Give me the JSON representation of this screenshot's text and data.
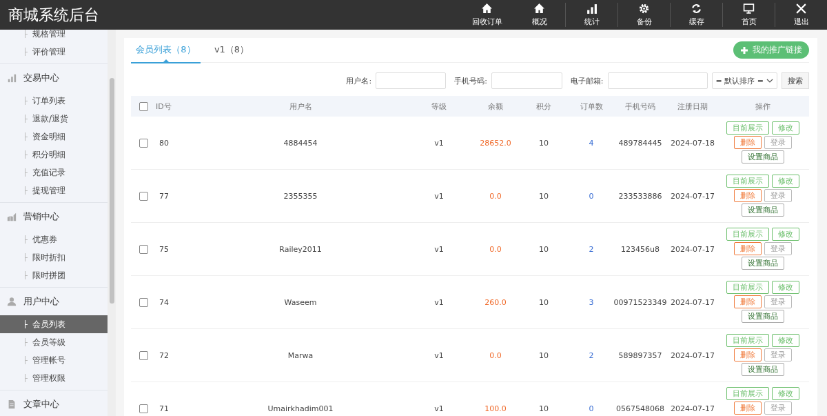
{
  "header": {
    "title": "商城系统后台",
    "nav": [
      {
        "label": "回收订单"
      },
      {
        "label": "概况"
      },
      {
        "label": "统计"
      },
      {
        "label": "备份"
      },
      {
        "label": "缓存"
      },
      {
        "label": "首页"
      },
      {
        "label": "退出"
      }
    ]
  },
  "sidebar": {
    "sections": [
      {
        "items": [
          {
            "label": "规格管理",
            "selected": false
          },
          {
            "label": "评价管理",
            "selected": false
          }
        ]
      },
      {
        "title": "交易中心",
        "items": [
          {
            "label": "订单列表",
            "selected": false
          },
          {
            "label": "退款/退货",
            "selected": false
          },
          {
            "label": "资金明细",
            "selected": false
          },
          {
            "label": "积分明细",
            "selected": false
          },
          {
            "label": "充值记录",
            "selected": false
          },
          {
            "label": "提现管理",
            "selected": false
          }
        ]
      },
      {
        "title": "营销中心",
        "items": [
          {
            "label": "优惠券",
            "selected": false
          },
          {
            "label": "限时折扣",
            "selected": false
          },
          {
            "label": "限时拼团",
            "selected": false
          }
        ]
      },
      {
        "title": "用户中心",
        "items": [
          {
            "label": "会员列表",
            "selected": true
          },
          {
            "label": "会员等级",
            "selected": false
          },
          {
            "label": "管理帐号",
            "selected": false
          },
          {
            "label": "管理权限",
            "selected": false
          }
        ]
      },
      {
        "title": "文章中心"
      }
    ]
  },
  "tabs": [
    {
      "label": "会员列表（8）",
      "selected": true
    },
    {
      "label": "v1（8）",
      "selected": false
    }
  ],
  "promo_button": "我的推广链接",
  "filters": {
    "fields": [
      {
        "label": "用户名:"
      },
      {
        "label": "手机号码:"
      },
      {
        "label": "电子邮箱:"
      }
    ],
    "sort": "= 默认排序 =",
    "search": "搜索"
  },
  "table": {
    "all_checked": false,
    "columns": [
      "ID号",
      "用户名",
      "等级",
      "余额",
      "积分",
      "订单数",
      "手机号码",
      "注册日期",
      "操作"
    ],
    "rows": [
      {
        "checked": false,
        "cells": [
          "80",
          "4884454",
          "v1",
          "28652.0",
          "10",
          "4",
          "489784445",
          "2024-07-18"
        ],
        "actions": [
          {
            "label": "目前展示",
            "kind": "show"
          },
          {
            "label": "修改",
            "kind": "edit"
          },
          {
            "label": "删除",
            "kind": "delete"
          },
          {
            "label": "登录",
            "kind": "login"
          },
          {
            "label": "设置商品",
            "kind": "goods"
          }
        ]
      },
      {
        "checked": false,
        "cells": [
          "77",
          "2355355",
          "v1",
          "0.0",
          "10",
          "0",
          "233533886",
          "2024-07-17"
        ],
        "actions": [
          {
            "label": "目前展示",
            "kind": "show"
          },
          {
            "label": "修改",
            "kind": "edit"
          },
          {
            "label": "删除",
            "kind": "delete"
          },
          {
            "label": "登录",
            "kind": "login"
          },
          {
            "label": "设置商品",
            "kind": "goods"
          }
        ]
      },
      {
        "checked": false,
        "cells": [
          "75",
          "Railey2011",
          "v1",
          "0.0",
          "10",
          "2",
          "123456u8",
          "2024-07-17"
        ],
        "actions": [
          {
            "label": "目前展示",
            "kind": "show"
          },
          {
            "label": "修改",
            "kind": "edit"
          },
          {
            "label": "删除",
            "kind": "delete"
          },
          {
            "label": "登录",
            "kind": "login"
          },
          {
            "label": "设置商品",
            "kind": "goods"
          }
        ]
      },
      {
        "checked": false,
        "cells": [
          "74",
          "Waseem",
          "v1",
          "260.0",
          "10",
          "3",
          "00971523349",
          "2024-07-17"
        ],
        "actions": [
          {
            "label": "目前展示",
            "kind": "show"
          },
          {
            "label": "修改",
            "kind": "edit"
          },
          {
            "label": "删除",
            "kind": "delete"
          },
          {
            "label": "登录",
            "kind": "login"
          },
          {
            "label": "设置商品",
            "kind": "goods"
          }
        ]
      },
      {
        "checked": false,
        "cells": [
          "72",
          "Marwa",
          "v1",
          "0.0",
          "10",
          "2",
          "589897357",
          "2024-07-17"
        ],
        "actions": [
          {
            "label": "目前展示",
            "kind": "show"
          },
          {
            "label": "修改",
            "kind": "edit"
          },
          {
            "label": "删除",
            "kind": "delete"
          },
          {
            "label": "登录",
            "kind": "login"
          },
          {
            "label": "设置商品",
            "kind": "goods"
          }
        ]
      },
      {
        "checked": false,
        "cells": [
          "71",
          "Umairkhadim001",
          "v1",
          "100.0",
          "10",
          "0",
          "0567548068",
          "2024-07-17"
        ],
        "actions": [
          {
            "label": "目前展示",
            "kind": "show"
          },
          {
            "label": "修改",
            "kind": "edit"
          },
          {
            "label": "删除",
            "kind": "delete"
          },
          {
            "label": "登录",
            "kind": "login"
          }
        ]
      }
    ]
  }
}
